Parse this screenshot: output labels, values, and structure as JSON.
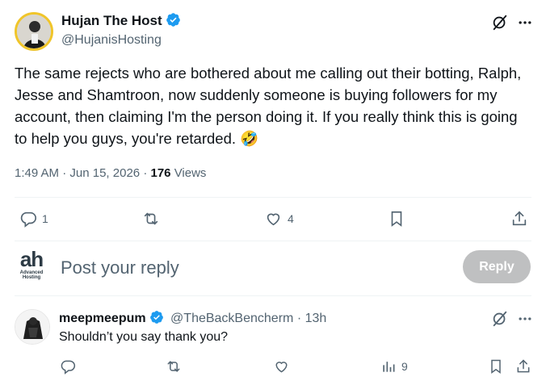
{
  "main_tweet": {
    "author_name": "Hujan The Host",
    "author_handle": "@HujanisHosting",
    "text": "The same rejects who are bothered about me calling out their botting, Ralph, Jesse and Shamtroon, now suddenly someone is buying followers for my account, then claiming I'm the person doing it. If you really think this is going to help you guys, you're retarded. 🤣",
    "time": "1:49 AM",
    "separator": "·",
    "date": "Jun 15, 2026",
    "separator2": "·",
    "views_count": "176",
    "views_label": "Views",
    "reply_count": "1",
    "like_count": "4",
    "icons": [
      "grok-icon",
      "more-icon",
      "reply-icon",
      "retweet-icon",
      "like-icon",
      "bookmark-icon",
      "share-icon"
    ]
  },
  "composer": {
    "logo_text": "ah",
    "logo_subtext": "Advanced\nHosting",
    "placeholder": "Post your reply",
    "button_label": "Reply"
  },
  "reply_tweet": {
    "author_name": "meepmeepum",
    "author_handle": "@TheBackBencherm",
    "separator": "·",
    "time_ago": "13h",
    "text": "Shouldn’t you say thank you?",
    "views_count": "9"
  },
  "colors": {
    "verified": "#1d9bf0",
    "icon_gray": "#536471",
    "reply_button_disabled": "#bfc0c1"
  }
}
